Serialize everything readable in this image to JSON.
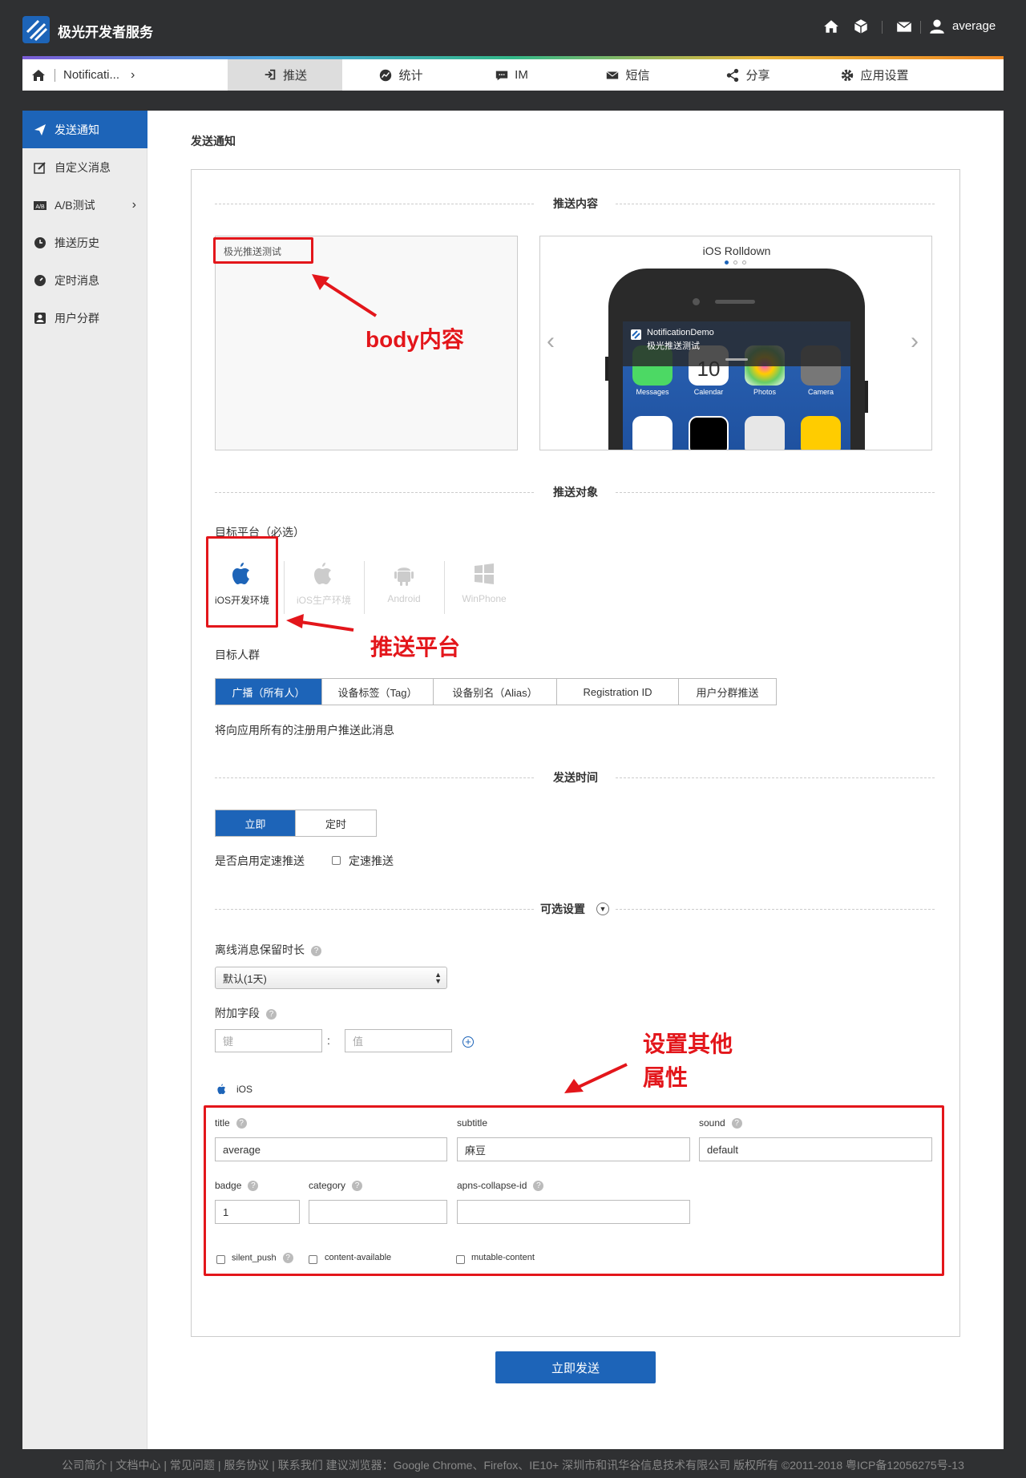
{
  "header": {
    "brand": "极光开发者服务",
    "user": "average"
  },
  "nav": {
    "breadcrumb": "Notificati...",
    "tabs": [
      {
        "label": "推送"
      },
      {
        "label": "统计"
      },
      {
        "label": "IM"
      },
      {
        "label": "短信"
      },
      {
        "label": "分享"
      },
      {
        "label": "应用设置"
      }
    ]
  },
  "sidebar": {
    "items": [
      {
        "label": "发送通知"
      },
      {
        "label": "自定义消息"
      },
      {
        "label": "A/B测试"
      },
      {
        "label": "推送历史"
      },
      {
        "label": "定时消息"
      },
      {
        "label": "用户分群"
      }
    ]
  },
  "page": {
    "title": "发送通知"
  },
  "sections": {
    "content": "推送内容",
    "target": "推送对象",
    "time": "发送时间",
    "optional": "可选设置"
  },
  "content": {
    "body": "极光推送测试",
    "preview": {
      "title": "iOS Rolldown",
      "app_name": "NotificationDemo",
      "message": "极光推送测试",
      "apps": [
        "Messages",
        "Calendar",
        "Photos",
        "Camera"
      ],
      "calendar_day": "10"
    }
  },
  "target": {
    "platform_label": "目标平台（必选）",
    "platforms": [
      "iOS开发环境",
      "iOS生产环境",
      "Android",
      "WinPhone"
    ],
    "audience_label": "目标人群",
    "audience_tabs": [
      "广播（所有人）",
      "设备标签（Tag）",
      "设备别名（Alias）",
      "Registration ID",
      "用户分群推送"
    ],
    "audience_desc": "将向应用所有的注册用户推送此消息"
  },
  "time": {
    "tabs": [
      "立即",
      "定时"
    ],
    "rate_label": "是否启用定速推送",
    "rate_checkbox": "定速推送"
  },
  "optional": {
    "offline_label": "离线消息保留时长",
    "offline_value": "默认(1天)",
    "extra_label": "附加字段",
    "key_placeholder": "键",
    "value_placeholder": "值",
    "colon": ":",
    "ios_label": "iOS",
    "fields": {
      "title_label": "title",
      "title_value": "average",
      "subtitle_label": "subtitle",
      "subtitle_value": "麻豆",
      "sound_label": "sound",
      "sound_value": "default",
      "badge_label": "badge",
      "badge_value": "1",
      "category_label": "category",
      "category_value": "",
      "collapse_label": "apns-collapse-id",
      "collapse_value": "",
      "silent_push": "silent_push",
      "content_available": "content-available",
      "mutable_content": "mutable-content"
    }
  },
  "annotations": {
    "body": "body内容",
    "platform": "推送平台",
    "other_line1": "设置其他",
    "other_line2": "属性"
  },
  "send_button": "立即发送",
  "footer": "公司简介 | 文档中心 | 常见问题 | 服务协议 | 联系我们    建议浏览器：Google Chrome、Firefox、IE10+    深圳市和讯华谷信息技术有限公司 版权所有 ©2011-2018 粤ICP备12056275号-13",
  "colors": {
    "primary": "#1d64b8",
    "annotation": "#e3161b",
    "header_bg": "#2f3032"
  }
}
